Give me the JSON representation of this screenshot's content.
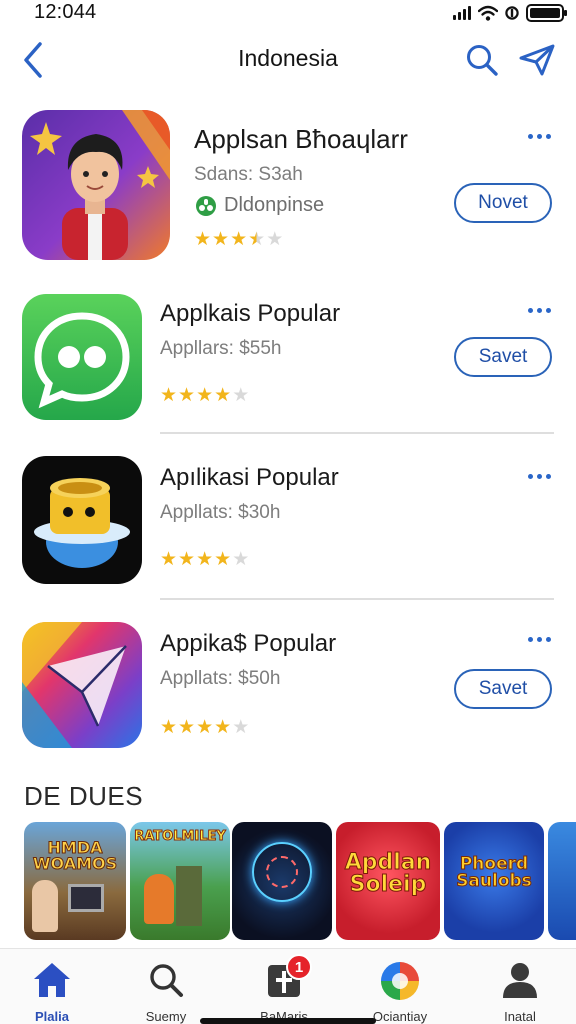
{
  "status": {
    "time": "12:044",
    "battery_level": 1.0
  },
  "nav": {
    "title": "Indonesia"
  },
  "apps": [
    {
      "name": "Applsan Bħoaɥlarr",
      "subtitle": "Sdans: S3ah",
      "developer": "Dldonpinse",
      "rating": 3.5,
      "button_label": "Novet"
    },
    {
      "name": "Applkais Popular",
      "subtitle": "Appllars: $55h",
      "rating": 4,
      "button_label": "Savet"
    },
    {
      "name": "Apılikasi Popular",
      "subtitle": "Appllats: $30h",
      "rating": 4
    },
    {
      "name": "Appika$ Popular",
      "subtitle": "Appllats: $50h",
      "rating": 4,
      "button_label": "Savet"
    }
  ],
  "section": {
    "title": "DE DUES",
    "thumbnails": [
      {
        "text": "HMDA WOAMOS"
      },
      {
        "text": "RATOLMILEY"
      },
      {
        "text": ""
      },
      {
        "text": "Apdlan Soleip"
      },
      {
        "text": "Phoerd Saulobs"
      }
    ]
  },
  "tabs": [
    {
      "label": "Plalia",
      "icon": "home-icon",
      "active": true
    },
    {
      "label": "Suemy",
      "icon": "search-icon"
    },
    {
      "label": "BaMaris",
      "icon": "apps-icon",
      "badge": "1"
    },
    {
      "label": "Ociantiay",
      "icon": "play-icon"
    },
    {
      "label": "Inatal",
      "icon": "person-icon"
    }
  ],
  "colors": {
    "accent": "#2a63b8",
    "star": "#f2b51c",
    "badge": "#e5232a"
  }
}
